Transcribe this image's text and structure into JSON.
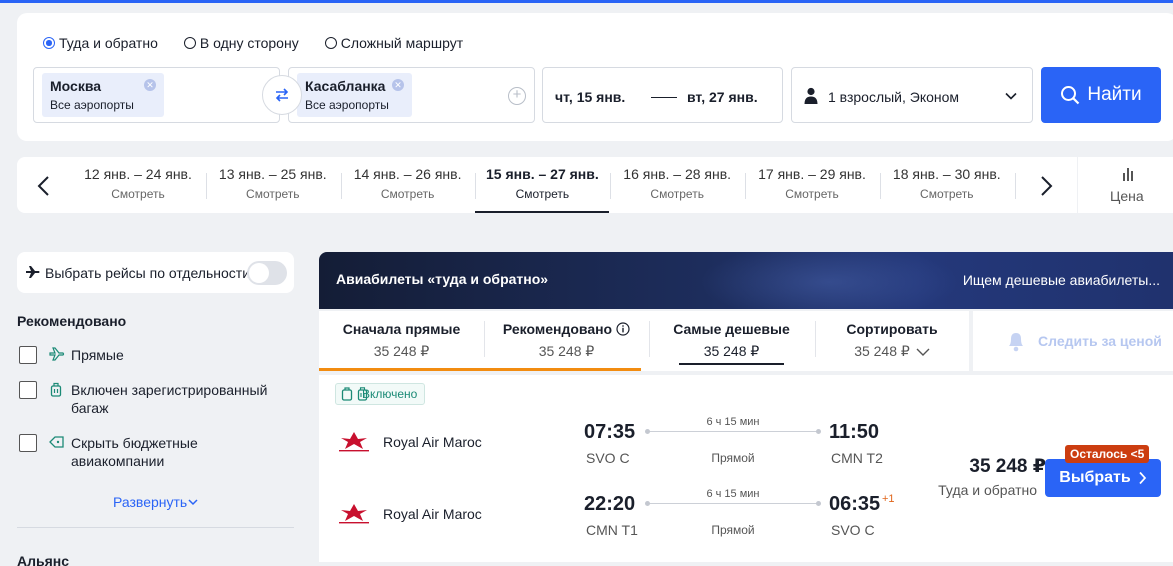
{
  "trip_type": {
    "options": [
      "Туда и обратно",
      "В одну сторону",
      "Сложный маршрут"
    ],
    "selected": "Туда и обратно"
  },
  "search": {
    "from_city": "Москва",
    "from_sub": "Все аэропорты",
    "to_city": "Касабланка",
    "to_sub": "Все аэропорты",
    "depart_date": "чт, 15 янв.",
    "return_date": "вт, 27 янв.",
    "passengers": "1 взрослый, Эконом",
    "search_label": "Найти"
  },
  "date_strip": {
    "items": [
      {
        "range": "12 янв. – 24 янв.",
        "action": "Смотреть"
      },
      {
        "range": "13 янв. – 25 янв.",
        "action": "Смотреть"
      },
      {
        "range": "14 янв. – 26 янв.",
        "action": "Смотреть"
      },
      {
        "range": "15 янв. – 27 янв.",
        "action": "Смотреть"
      },
      {
        "range": "16 янв. – 28 янв.",
        "action": "Смотреть"
      },
      {
        "range": "17 янв. – 29 янв.",
        "action": "Смотреть"
      },
      {
        "range": "18 янв. – 30 янв.",
        "action": "Смотреть"
      }
    ],
    "selected_index": 3,
    "price_label": "Цена"
  },
  "filters": {
    "separate_flights_label": "Выбрать рейсы по отдельности",
    "separate_flights_on": false,
    "recommended_title": "Рекомендовано",
    "options": [
      {
        "label": "Прямые",
        "icon": "direct-flight-icon",
        "checked": false
      },
      {
        "label": "Включен зарегистрированный багаж",
        "icon": "luggage-icon",
        "checked": false
      },
      {
        "label": "Скрыть бюджетные авиакомпании",
        "icon": "tag-icon",
        "checked": false
      }
    ],
    "expand_label": "Развернуть",
    "alliance_title": "Альянс"
  },
  "banner": {
    "title": "Авиабилеты «туда и обратно»",
    "status": "Ищем дешевые авиабилеты..."
  },
  "sort_tabs": [
    {
      "title": "Сначала прямые",
      "price": "35 248 ₽"
    },
    {
      "title": "Рекомендовано",
      "price": "35 248 ₽"
    },
    {
      "title": "Самые дешевые",
      "price": "35 248 ₽"
    },
    {
      "title": "Сортировать",
      "price": "35 248 ₽"
    }
  ],
  "sort_selected_index": 2,
  "track_price_label": "Следить за ценой",
  "ticket": {
    "included_label": "Включено",
    "segments": [
      {
        "airline": "Royal Air Maroc",
        "dep_time": "07:35",
        "dep_airport": "SVO C",
        "duration": "6 ч 15 мин",
        "stops": "Прямой",
        "arr_time": "11:50",
        "arr_airport": "CMN T2",
        "day_offset": ""
      },
      {
        "airline": "Royal Air Maroc",
        "dep_time": "22:20",
        "dep_airport": "CMN T1",
        "duration": "6 ч 15 мин",
        "stops": "Прямой",
        "arr_time": "06:35",
        "arr_airport": "SVO C",
        "day_offset": "+1"
      }
    ],
    "price": "35 248 ₽",
    "price_note": "Туда и обратно",
    "seats_left": "Осталось <5",
    "choose_label": "Выбрать"
  },
  "colors": {
    "accent": "#2a64f6",
    "sort_underline": "#f28c10",
    "seats_badge": "#cc3d10",
    "included_text": "#1b8a76"
  }
}
